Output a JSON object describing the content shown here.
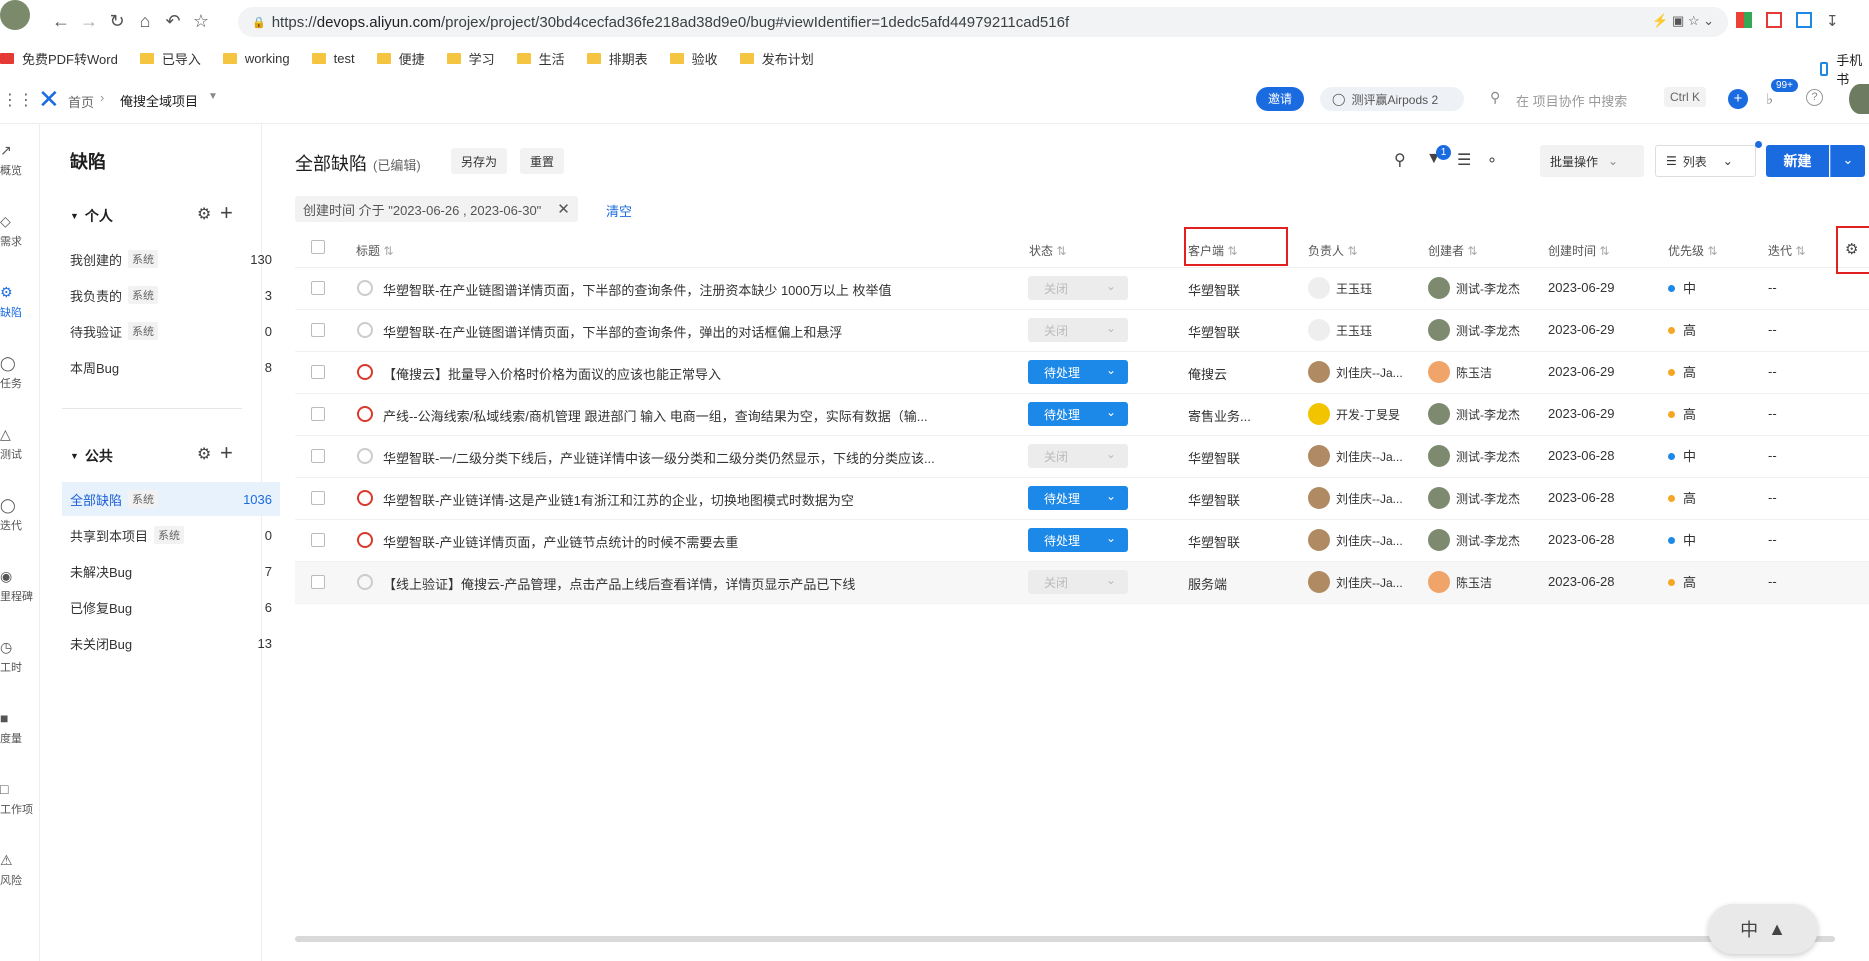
{
  "browser": {
    "url_prefix": "https://",
    "url_host": "devops.aliyun.com",
    "url_path": "/projex/project/30bd4cecfad36fe218ad38d9e0/bug#viewIdentifier=1dedc5afd44979211cad516f",
    "bookmarks": [
      "免费PDF转Word",
      "已导入",
      "working",
      "test",
      "便捷",
      "学习",
      "生活",
      "排期表",
      "验收",
      "发布计划"
    ],
    "mobile_label": "手机书"
  },
  "topbar": {
    "breadcrumb_home": "首页",
    "breadcrumb_project": "俺搜全域项目",
    "invite": "邀请",
    "promo": "测评赢Airpods 2",
    "search_placeholder": "在 项目协作 中搜索",
    "shortcut": "Ctrl K",
    "notif_count": "99+"
  },
  "rail": [
    "概览",
    "需求",
    "缺陷",
    "任务",
    "测试",
    "迭代",
    "里程碑",
    "工时",
    "度量",
    "工作项",
    "风险"
  ],
  "sidebar": {
    "title": "缺陷",
    "personal_label": "个人",
    "public_label": "公共",
    "system_tag": "系统",
    "personal": [
      {
        "label": "我创建的",
        "sys": true,
        "count": "130"
      },
      {
        "label": "我负责的",
        "sys": true,
        "count": "3"
      },
      {
        "label": "待我验证",
        "sys": true,
        "count": "0"
      },
      {
        "label": "本周Bug",
        "sys": false,
        "count": "8"
      }
    ],
    "public": [
      {
        "label": "全部缺陷",
        "sys": true,
        "count": "1036"
      },
      {
        "label": "共享到本项目",
        "sys": true,
        "count": "0"
      },
      {
        "label": "未解决Bug",
        "sys": false,
        "count": "7"
      },
      {
        "label": "已修复Bug",
        "sys": false,
        "count": "6"
      },
      {
        "label": "未关闭Bug",
        "sys": false,
        "count": "13"
      }
    ]
  },
  "main": {
    "title": "全部缺陷",
    "edited": "(已编辑)",
    "save_as": "另存为",
    "reset": "重置",
    "filter_badge": "1",
    "batch": "批量操作",
    "view": "列表",
    "new": "新建",
    "filter_text": "创建时间 介于 \"2023-06-26 , 2023-06-30\"",
    "clear": "清空"
  },
  "columns": [
    "标题",
    "状态",
    "客户端",
    "负责人",
    "创建者",
    "创建时间",
    "优先级",
    "迭代"
  ],
  "rows": [
    {
      "title": "华塑智联-在产业链图谱详情页面，下半部的查询条件，注册资本缺少 1000万以上 枚举值",
      "status": "关闭",
      "open": false,
      "client": "华塑智联",
      "owner": "王玉珏",
      "creator": "测试-李龙杰",
      "date": "2023-06-29",
      "prio": "中",
      "prio_color": "#1c88e8",
      "iter": "--"
    },
    {
      "title": "华塑智联-在产业链图谱详情页面，下半部的查询条件，弹出的对话框偏上和悬浮",
      "status": "关闭",
      "open": false,
      "client": "华塑智联",
      "owner": "王玉珏",
      "creator": "测试-李龙杰",
      "date": "2023-06-29",
      "prio": "高",
      "prio_color": "#f5a623",
      "iter": "--"
    },
    {
      "title": "【俺搜云】批量导入价格时价格为面议的应该也能正常导入",
      "status": "待处理",
      "open": true,
      "client": "俺搜云",
      "owner": "刘佳庆--Ja...",
      "creator": "陈玉洁",
      "date": "2023-06-29",
      "prio": "高",
      "prio_color": "#f5a623",
      "iter": "--"
    },
    {
      "title": "产线--公海线索/私域线索/商机管理 跟进部门 输入 电商一组，查询结果为空，实际有数据（输...",
      "status": "待处理",
      "open": true,
      "client": "寄售业务...",
      "owner": "开发-丁旻旻",
      "creator": "测试-李龙杰",
      "date": "2023-06-29",
      "prio": "高",
      "prio_color": "#f5a623",
      "iter": "--"
    },
    {
      "title": "华塑智联-一/二级分类下线后，产业链详情中该一级分类和二级分类仍然显示，下线的分类应该...",
      "status": "关闭",
      "open": false,
      "client": "华塑智联",
      "owner": "刘佳庆--Ja...",
      "creator": "测试-李龙杰",
      "date": "2023-06-28",
      "prio": "中",
      "prio_color": "#1c88e8",
      "iter": "--"
    },
    {
      "title": "华塑智联-产业链详情-这是产业链1有浙江和江苏的企业，切换地图模式时数据为空",
      "status": "待处理",
      "open": true,
      "client": "华塑智联",
      "owner": "刘佳庆--Ja...",
      "creator": "测试-李龙杰",
      "date": "2023-06-28",
      "prio": "高",
      "prio_color": "#f5a623",
      "iter": "--"
    },
    {
      "title": "华塑智联-产业链详情页面，产业链节点统计的时候不需要去重",
      "status": "待处理",
      "open": true,
      "client": "华塑智联",
      "owner": "刘佳庆--Ja...",
      "creator": "测试-李龙杰",
      "date": "2023-06-28",
      "prio": "中",
      "prio_color": "#1c88e8",
      "iter": "--"
    },
    {
      "title": "【线上验证】俺搜云-产品管理，点击产品上线后查看详情，详情页显示产品已下线",
      "status": "关闭",
      "open": false,
      "client": "服务端",
      "owner": "刘佳庆--Ja...",
      "creator": "陈玉洁",
      "date": "2023-06-28",
      "prio": "高",
      "prio_color": "#f5a623",
      "iter": "--"
    }
  ],
  "ime": {
    "label": "中"
  }
}
